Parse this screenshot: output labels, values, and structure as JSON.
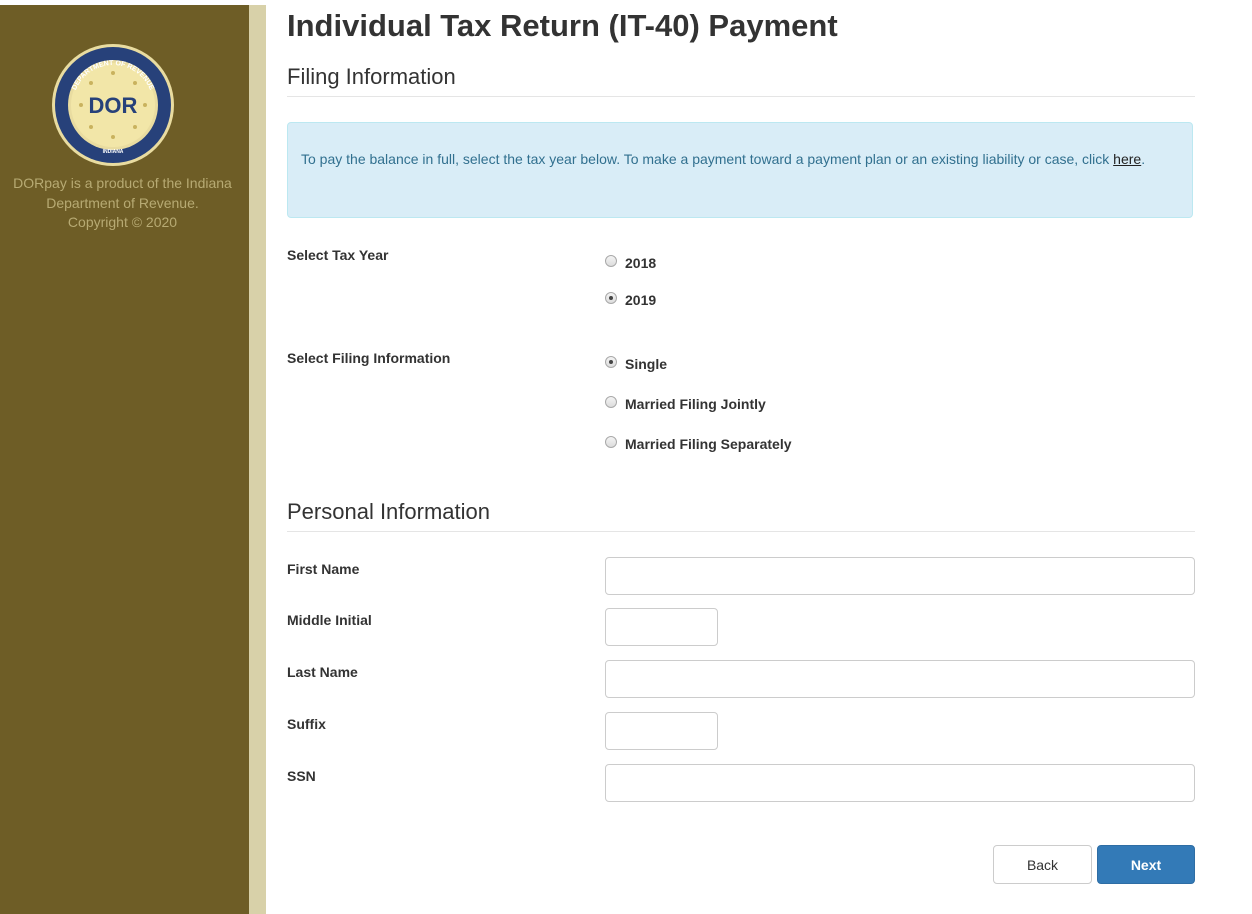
{
  "sidebar": {
    "seal": {
      "top_text": "DEPARTMENT OF REVENUE",
      "center_text": "DOR",
      "bottom_text": "INDIANA"
    },
    "text_lines": [
      "DORpay is a product of the Indiana",
      "Department of Revenue.",
      "Copyright © 2020"
    ]
  },
  "page": {
    "title": "Individual Tax Return (IT-40) Payment"
  },
  "filing": {
    "section_title": "Filing Information",
    "alert_text": "To pay the balance in full, select the tax year below. To make a payment toward a payment plan or an existing liability or case, click ",
    "alert_link": "here",
    "alert_end": ".",
    "tax_year_label": "Select Tax Year",
    "tax_years": [
      {
        "label": "2018",
        "checked": false
      },
      {
        "label": "2019",
        "checked": true
      }
    ],
    "filing_info_label": "Select Filing Information",
    "filing_statuses": [
      {
        "label": "Single",
        "checked": true
      },
      {
        "label": "Married Filing Jointly",
        "checked": false
      },
      {
        "label": "Married Filing Separately",
        "checked": false
      }
    ]
  },
  "personal": {
    "section_title": "Personal Information",
    "first_name_label": "First Name",
    "first_name_value": "",
    "middle_initial_label": "Middle Initial",
    "middle_initial_value": "",
    "last_name_label": "Last Name",
    "last_name_value": "",
    "suffix_label": "Suffix",
    "suffix_value": "",
    "ssn_label": "SSN",
    "ssn_value": ""
  },
  "buttons": {
    "back": "Back",
    "next": "Next"
  },
  "colors": {
    "sidebar": "#6e5d26",
    "sidebar_edge": "#d8d1a9",
    "alert_bg": "#d9edf7",
    "primary": "#337ab7"
  }
}
